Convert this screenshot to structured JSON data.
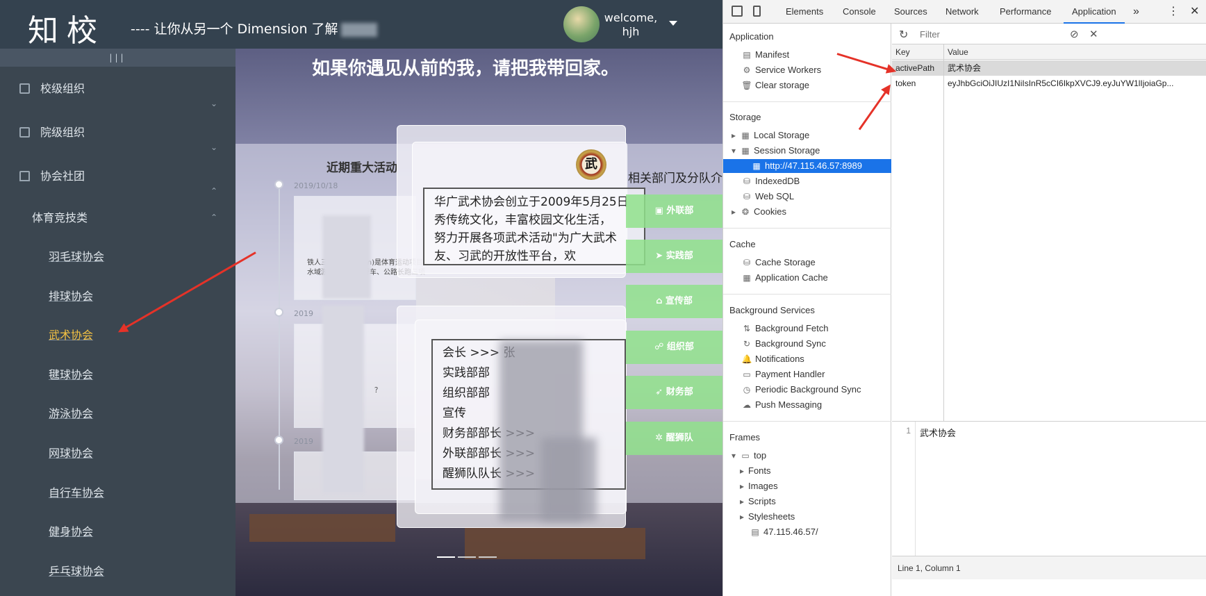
{
  "header": {
    "logo": "知校",
    "slogan": "---- 让你从另一个 Dimension 了解",
    "welcome_line1": "welcome,",
    "welcome_line2": "hjh"
  },
  "sidebar": {
    "toggle": "|||",
    "groups": [
      {
        "label": "校级组织",
        "arrow": "⌄"
      },
      {
        "label": "院级组织",
        "arrow": "⌄"
      },
      {
        "label": "协会社团",
        "arrow": "⌃"
      }
    ],
    "sub_group": {
      "label": "体育竞技类",
      "arrow": "⌃"
    },
    "items": [
      "羽毛球协会",
      "排球协会",
      "武术协会",
      "毽球协会",
      "游泳协会",
      "网球协会",
      "自行车协会",
      "健身协会",
      "乒乓球协会"
    ],
    "active_item": "武术协会"
  },
  "main": {
    "title": "如果你遇见从前的我，请把我带回家。",
    "timeline_title": "近期重大活动",
    "dates": [
      "2019/10/18",
      "2019",
      "2019"
    ],
    "card_text_1": "铁人三项（Triathlon)是体育运动项目之一，由天然水域游泳、公路自行车、公路长跑三项",
    "card_text_2": "？",
    "seal_char": "武",
    "intro_lines": [
      "华广武术协会创立于2009年5月25日",
      "秀传统文化，丰富校园文化生活，",
      "努力开展各项武术活动\"为广大武术",
      "友、习武的开放性平台，欢"
    ],
    "roster_lines": [
      "会长 >>> 张",
      "实践部部",
      "组织部部",
      "宣传",
      "财务部部长 >>>",
      "外联部部长 >>>",
      "醒狮队队长 >>>"
    ],
    "dept_title": "相关部门及分队介",
    "departments": [
      {
        "icon": "▣",
        "label": "外联部"
      },
      {
        "icon": "➤",
        "label": "实践部"
      },
      {
        "icon": "⌂",
        "label": "宣传部"
      },
      {
        "icon": "☍",
        "label": "组织部"
      },
      {
        "icon": "➶",
        "label": "财务部"
      },
      {
        "icon": "✲",
        "label": "醒狮队"
      }
    ]
  },
  "devtools": {
    "tabs": [
      "Elements",
      "Console",
      "Sources",
      "Network",
      "Performance",
      "Application"
    ],
    "more": "»",
    "active_tab": "Application",
    "sections": {
      "application": {
        "title": "Application",
        "items": [
          "Manifest",
          "Service Workers",
          "Clear storage"
        ]
      },
      "storage": {
        "title": "Storage",
        "items": [
          "Local Storage",
          "Session Storage",
          "http://47.115.46.57:8989",
          "IndexedDB",
          "Web SQL",
          "Cookies"
        ]
      },
      "cache": {
        "title": "Cache",
        "items": [
          "Cache Storage",
          "Application Cache"
        ]
      },
      "background": {
        "title": "Background Services",
        "items": [
          "Background Fetch",
          "Background Sync",
          "Notifications",
          "Payment Handler",
          "Periodic Background Sync",
          "Push Messaging"
        ]
      },
      "frames": {
        "title": "Frames",
        "items": [
          "top",
          "Fonts",
          "Images",
          "Scripts",
          "Stylesheets",
          "47.115.46.57/"
        ]
      }
    },
    "filter_placeholder": "Filter",
    "table": {
      "headers": [
        "Key",
        "Value"
      ],
      "rows": [
        {
          "key": "activePath",
          "value": "武术协会"
        },
        {
          "key": "token",
          "value": "eyJhbGciOiJIUzI1NiIsInR5cCI6IkpXVCJ9.eyJuYW1lIjoiaGp..."
        }
      ]
    },
    "preview": {
      "line_no": "1",
      "text": "武术协会"
    },
    "status": "Line 1, Column 1"
  }
}
